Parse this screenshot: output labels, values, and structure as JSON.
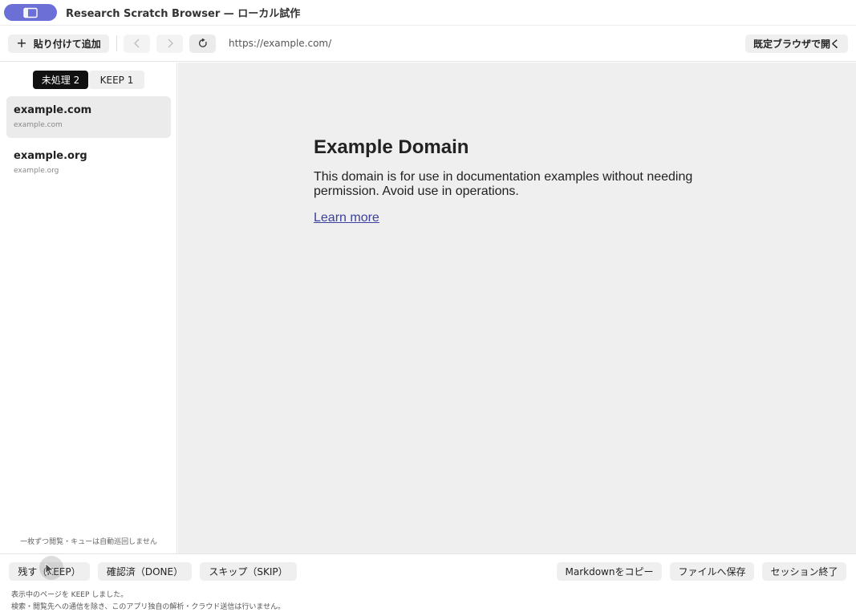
{
  "app": {
    "title": "Research Scratch Browser — ローカル試作",
    "icon": "browser-window-icon",
    "accent_color": "#6b6fd6"
  },
  "toolbar": {
    "add_button": {
      "icon": "plus-icon",
      "label": "貼り付けて追加"
    },
    "back_icon": "chevron-left-icon",
    "forward_icon": "chevron-right-icon",
    "reload_icon": "reload-icon",
    "url": "https://example.com/",
    "open_default_label": "既定ブラウザで開く"
  },
  "sidebar": {
    "tabs": [
      {
        "label": "未処理 2",
        "active": true
      },
      {
        "label": "KEEP 1",
        "active": false
      }
    ],
    "items": [
      {
        "title": "example.com",
        "subtitle": "example.com",
        "selected": true
      },
      {
        "title": "example.org",
        "subtitle": "example.org",
        "selected": false
      }
    ],
    "note": "一枚ずつ閲覧・キューは自動巡回しません"
  },
  "content": {
    "heading": "Example Domain",
    "paragraph": "This domain is for use in documentation examples without needing permission. Avoid use in operations.",
    "link": "Learn more"
  },
  "bottom": {
    "keep_label": "残す（KEEP）",
    "done_label": "確認済（DONE）",
    "skip_label": "スキップ（SKIP）",
    "copy_md_label": "Markdownをコピー",
    "save_file_label": "ファイルへ保存",
    "end_session_label": "セッション終了",
    "status_line1": "表示中のページを KEEP しました。",
    "status_line2": "検索・閲覧先への通信を除き、このアプリ独自の解析・クラウド送信は行いません。"
  }
}
